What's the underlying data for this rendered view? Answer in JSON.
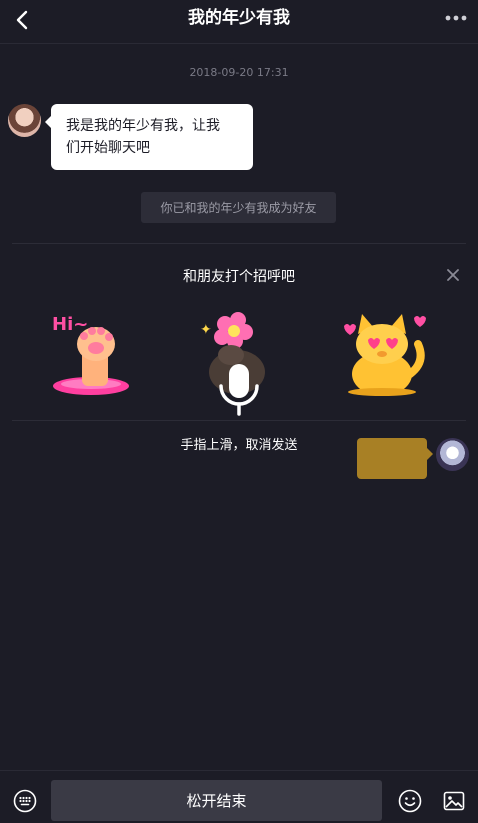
{
  "header": {
    "title": "我的年少有我",
    "back_icon": "chevron-left-icon",
    "more_icon": "more-horizontal-icon"
  },
  "chat": {
    "timestamp": "2018-09-20 17:31",
    "incoming_message": {
      "line1": "我是我的年少有我，让我",
      "line2": "们开始聊天吧"
    },
    "system_notice": "你已和我的年少有我成为好友",
    "outgoing_bubble_color": "#a88025"
  },
  "greeting_panel": {
    "title": "和朋友打个招呼吧",
    "close_icon": "close-icon",
    "stickers": [
      {
        "name": "hi-paw-sticker",
        "text": "Hi~"
      },
      {
        "name": "flower-sticker"
      },
      {
        "name": "heart-eyes-cat-sticker"
      }
    ]
  },
  "voice_recording": {
    "hint": "手指上滑，取消发送",
    "icon": "microphone-icon"
  },
  "input_bar": {
    "keyboard_icon": "keyboard-icon",
    "release_label": "松开结束",
    "emoji_icon": "emoji-icon",
    "image_icon": "image-icon"
  },
  "colors": {
    "background": "#1c1c26",
    "accent_pink": "#ff4fa3",
    "accent_yellow": "#ffc233"
  }
}
